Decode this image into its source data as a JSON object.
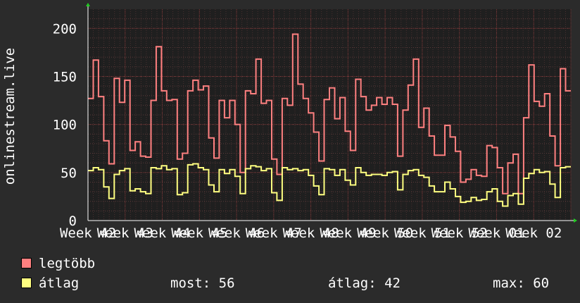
{
  "chart_data": {
    "type": "line",
    "ylabel": "onlinestream.live",
    "ylim": [
      0,
      220
    ],
    "yticks": [
      0,
      50,
      100,
      150,
      200
    ],
    "x_tick_labels": [
      "Week 42",
      "Week 43",
      "Week 44",
      "Week 45",
      "Week 46",
      "Week 47",
      "Week 48",
      "Week 49",
      "Week 50",
      "Week 51",
      "Week 52",
      "Week 01",
      "Week 02"
    ],
    "grid": true,
    "legend_position": "bottom-left",
    "series": [
      {
        "name": "legtöbb",
        "color": "#ff8080",
        "values": [
          127,
          167,
          129,
          83,
          59,
          148,
          123,
          146,
          73,
          82,
          67,
          66,
          125,
          181,
          135,
          125,
          126,
          64,
          70,
          135,
          146,
          136,
          140,
          86,
          65,
          125,
          107,
          125,
          100,
          50,
          135,
          132,
          168,
          122,
          125,
          64,
          48,
          127,
          120,
          194,
          142,
          127,
          112,
          92,
          62,
          126,
          138,
          106,
          128,
          93,
          73,
          147,
          129,
          115,
          120,
          128,
          121,
          128,
          121,
          67,
          115,
          141,
          168,
          97,
          117,
          88,
          68,
          68,
          99,
          87,
          72,
          40,
          43,
          53,
          47,
          46,
          78,
          76,
          55,
          28,
          60,
          69,
          28,
          107,
          162,
          124,
          119,
          132,
          88,
          57,
          158,
          135
        ],
        "values_step": "weekly, 7 samples per week"
      },
      {
        "name": "átlag",
        "color": "#ffff80",
        "values": [
          52,
          55,
          53,
          35,
          23,
          48,
          52,
          54,
          31,
          33,
          30,
          28,
          55,
          54,
          57,
          53,
          54,
          27,
          29,
          58,
          59,
          55,
          53,
          37,
          30,
          53,
          49,
          53,
          46,
          28,
          54,
          57,
          56,
          52,
          54,
          29,
          21,
          55,
          53,
          54,
          52,
          53,
          47,
          36,
          27,
          54,
          53,
          47,
          53,
          42,
          37,
          55,
          50,
          47,
          48,
          48,
          47,
          50,
          51,
          32,
          48,
          52,
          53,
          47,
          45,
          36,
          30,
          30,
          40,
          33,
          25,
          19,
          20,
          24,
          21,
          22,
          30,
          33,
          20,
          15,
          26,
          28,
          17,
          44,
          49,
          53,
          50,
          51,
          38,
          24,
          55,
          56
        ]
      }
    ],
    "stats": {
      "most_label": "most:",
      "most_value": "56",
      "atlag_label": "átlag:",
      "atlag_value": "42",
      "max_label": "max:",
      "max_value": "60"
    }
  }
}
